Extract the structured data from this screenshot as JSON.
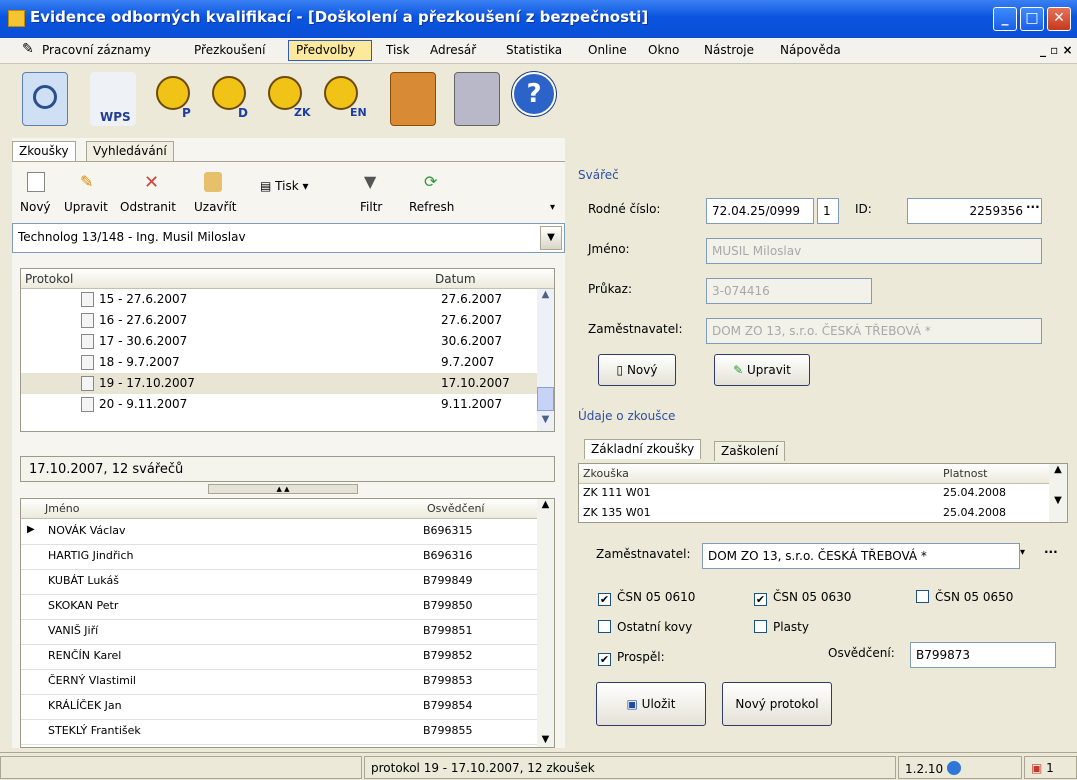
{
  "window": {
    "title": "Evidence odborných kvalifikací - [Doškolení a přezkoušení z bezpečnosti]"
  },
  "menu": [
    "Pracovní záznamy",
    "Přezkoušení",
    "Předvolby",
    "Tisk",
    "Adresář",
    "Statistika",
    "Online",
    "Okno",
    "Nástroje",
    "Nápověda"
  ],
  "toolbar_icons": [
    {
      "icon": "search-icon"
    },
    {
      "icon": "wps-document-icon",
      "label": "WPS"
    },
    {
      "icon": "welder-p-icon",
      "label": "P"
    },
    {
      "icon": "welder-d-icon",
      "label": "D"
    },
    {
      "icon": "welder-zk-icon",
      "label": "ZK"
    },
    {
      "icon": "welder-en-icon",
      "label": "EN"
    },
    {
      "icon": "book-icon"
    },
    {
      "icon": "computer-icon"
    },
    {
      "icon": "help-icon",
      "label": "?"
    }
  ],
  "tabs": {
    "left": [
      "Zkoušky",
      "Vyhledávání"
    ]
  },
  "actions": {
    "new": "Nový",
    "edit": "Upravit",
    "remove": "Odstranit",
    "close": "Uzavřít",
    "print": "Tisk",
    "filter": "Filtr",
    "refresh": "Refresh"
  },
  "technolog": "Technolog 13/148 - Ing. Musil Miloslav",
  "protocols": {
    "col1": "Protokol",
    "col2": "Datum",
    "rows": [
      {
        "name": "15 - 27.6.2007",
        "date": "27.6.2007"
      },
      {
        "name": "16 - 27.6.2007",
        "date": "27.6.2007"
      },
      {
        "name": "17 - 30.6.2007",
        "date": "30.6.2007"
      },
      {
        "name": "18 - 9.7.2007",
        "date": "9.7.2007"
      },
      {
        "name": "19 - 17.10.2007",
        "date": "17.10.2007"
      },
      {
        "name": "20 - 9.11.2007",
        "date": "9.11.2007"
      }
    ]
  },
  "info": "17.10.2007, 12 svářečů",
  "people": {
    "col1": "Jméno",
    "col2": "Osvědčení",
    "rows": [
      {
        "name": "NOVÁK Václav",
        "cert": "B696315"
      },
      {
        "name": "HARTIG Jindřich",
        "cert": "B696316"
      },
      {
        "name": "KUBÁT Lukáš",
        "cert": "B799849"
      },
      {
        "name": "SKOKAN Petr",
        "cert": "B799850"
      },
      {
        "name": "VANIŠ Jiří",
        "cert": "B799851"
      },
      {
        "name": "RENČÍN Karel",
        "cert": "B799852"
      },
      {
        "name": "ČERNÝ Vlastimil",
        "cert": "B799853"
      },
      {
        "name": "KRÁLÍČEK Jan",
        "cert": "B799854"
      },
      {
        "name": "STEKLÝ František",
        "cert": "B799855"
      }
    ]
  },
  "welder": {
    "group": "Svářeč",
    "rc_label": "Rodné číslo:",
    "rc": "72.04.25/0999",
    "rc_num": "1",
    "id_label": "ID:",
    "id": "2259356",
    "name_label": "Jméno:",
    "name": "MUSIL Miloslav",
    "card_label": "Průkaz:",
    "card": "3-074416",
    "emp_label": "Zaměstnavatel:",
    "emp": "DOM ZO 13, s.r.o. ČESKÁ TŘEBOVÁ  *",
    "btn_new": "Nový",
    "btn_edit": "Upravit"
  },
  "exam": {
    "group": "Údaje o zkoušce",
    "tabs": [
      "Základní zkoušky",
      "Zaškolení"
    ],
    "col1": "Zkouška",
    "col2": "Platnost",
    "rows": [
      {
        "exam": "ZK 111 W01",
        "valid": "25.04.2008"
      },
      {
        "exam": "ZK 135 W01",
        "valid": "25.04.2008"
      }
    ],
    "emp_label": "Zaměstnavatel:",
    "emp": "DOM ZO 13, s.r.o. ČESKÁ TŘEBOVÁ  *",
    "checks": [
      {
        "label": "ČSN 05 0610",
        "checked": true
      },
      {
        "label": "ČSN 05 0630",
        "checked": true
      },
      {
        "label": "ČSN 05 0650",
        "checked": false
      },
      {
        "label": "Ostatní kovy",
        "checked": false
      },
      {
        "label": "Plasty",
        "checked": false
      },
      {
        "label": "Prospěl:",
        "checked": true
      }
    ],
    "cert_label": "Osvědčení:",
    "cert": "B799873",
    "btn_save": "Uložit",
    "btn_newproto": "Nový protokol"
  },
  "status": {
    "text": "protokol 19 - 17.10.2007, 12 zkoušek",
    "version": "1.2.10",
    "right": "1"
  }
}
